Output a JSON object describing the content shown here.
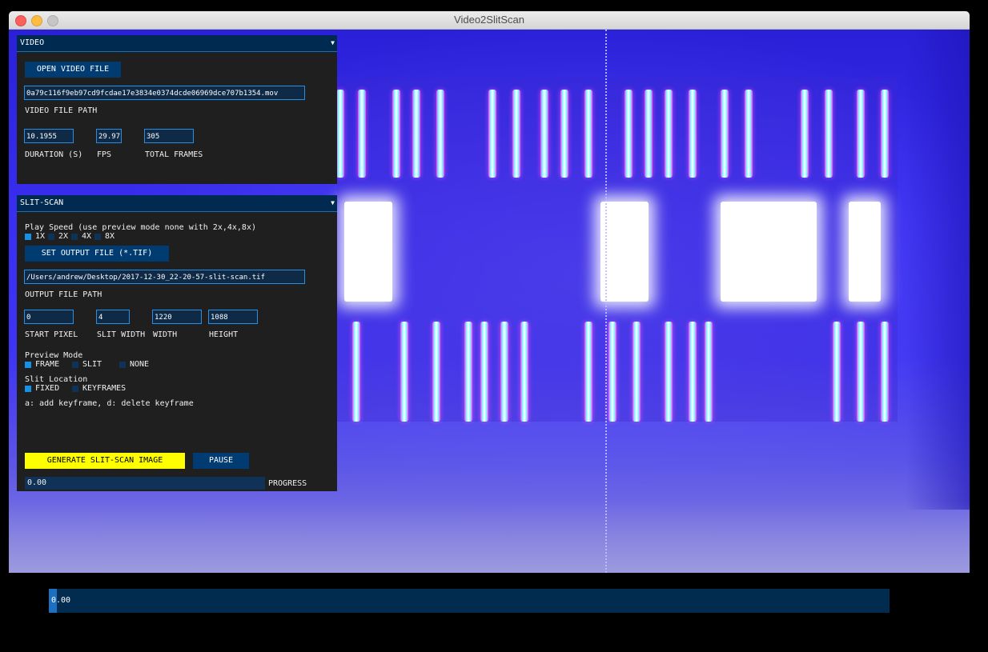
{
  "window": {
    "title": "Video2SlitScan"
  },
  "video_panel": {
    "header": "VIDEO",
    "open_button": "OPEN VIDEO FILE",
    "file_path_value": "0a79c116f9eb97cd9fcdae17e3834e0374dcde06969dce707b1354.mov",
    "file_path_label": "VIDEO FILE PATH",
    "duration_value": "10.1955",
    "duration_label": "DURATION (S)",
    "fps_value": "29.97",
    "fps_label": "FPS",
    "total_frames_value": "305",
    "total_frames_label": "TOTAL FRAMES"
  },
  "slitscan_panel": {
    "header": "SLIT-SCAN",
    "play_speed_label": "Play Speed (use preview mode none with 2x,4x,8x)",
    "play_speed_options": [
      "1X",
      "2X",
      "4X",
      "8X"
    ],
    "play_speed_selected": "1X",
    "output_button": "SET OUTPUT FILE (*.TIF)",
    "output_path_value": "/Users/andrew/Desktop/2017-12-30_22-20-57-slit-scan.tif",
    "output_path_label": "OUTPUT FILE PATH",
    "start_pixel_value": "0",
    "start_pixel_label": "START PIXEL",
    "slit_width_value": "4",
    "slit_width_label": "SLIT WIDTH",
    "width_value": "1220",
    "width_label": "WIDTH",
    "height_value": "1088",
    "height_label": "HEIGHT",
    "preview_mode_label": "Preview Mode",
    "preview_mode_options": [
      "FRAME",
      "SLIT",
      "NONE"
    ],
    "preview_mode_selected": "FRAME",
    "slit_location_label": "Slit Location",
    "slit_location_options": [
      "FIXED",
      "KEYFRAMES"
    ],
    "slit_location_selected": "FIXED",
    "keyframe_hint": "a: add keyframe, d: delete keyframe",
    "generate_button": "GENERATE SLIT-SCAN IMAGE",
    "pause_button": "PAUSE",
    "progress_value": "0.00",
    "progress_label": "PROGRESS"
  },
  "timeline": {
    "value": "0.00",
    "position_fraction": 0.0
  },
  "colors": {
    "panel_header": "#002a50",
    "button": "#003c72",
    "accent": "#1592e6",
    "generate_button": "#ffff00",
    "preview_blue": "#3a2ef0"
  }
}
